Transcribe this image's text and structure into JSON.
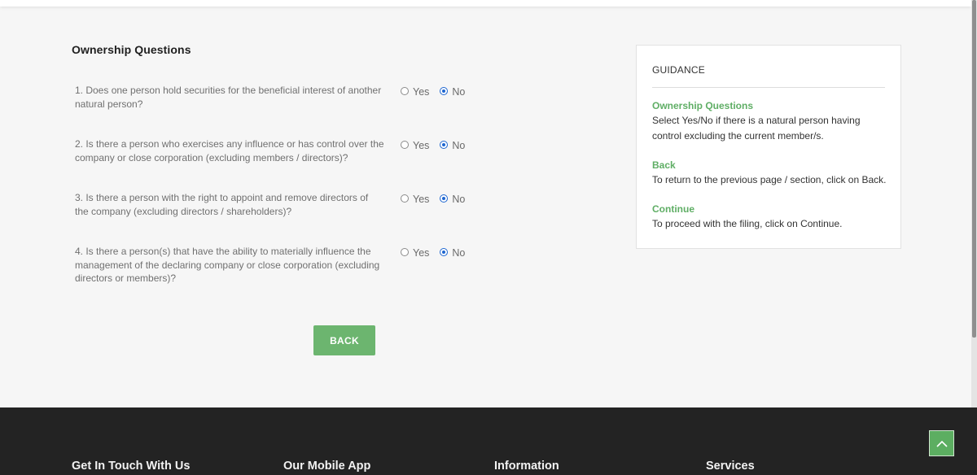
{
  "section_title": "Ownership Questions",
  "questions": [
    {
      "text": "1. Does one person hold securities for the beneficial interest of another natural person?",
      "selected": "No"
    },
    {
      "text": "2. Is there a person who exercises any influence or has control over the company or close corporation (excluding members / directors)?",
      "selected": "No"
    },
    {
      "text": "3. Is there a person with the right to appoint and remove directors of the company (excluding directors / shareholders)?",
      "selected": "No"
    },
    {
      "text": "4. Is there a person(s) that have the ability to materially influence the management of the declaring company or close corporation (excluding directors or members)?",
      "selected": "No"
    }
  ],
  "options": {
    "yes": "Yes",
    "no": "No"
  },
  "back_button": "BACK",
  "guidance": {
    "title": "GUIDANCE",
    "sections": [
      {
        "heading": "Ownership Questions",
        "text": "Select Yes/No if there is a natural person having control excluding the current member/s."
      },
      {
        "heading": "Back",
        "text": "To return to the previous page / section, click on Back."
      },
      {
        "heading": "Continue",
        "text": "To proceed with the filing, click on Continue."
      }
    ]
  },
  "footer": {
    "headings": [
      "Get In Touch With Us",
      "Our Mobile App",
      "Information",
      "Services"
    ]
  },
  "icons": {
    "scroll_top": "chevron-up-icon"
  },
  "colors": {
    "accent_green": "#6cb56f",
    "footer_bg": "#232323",
    "radio_selected": "#1e66d0"
  }
}
